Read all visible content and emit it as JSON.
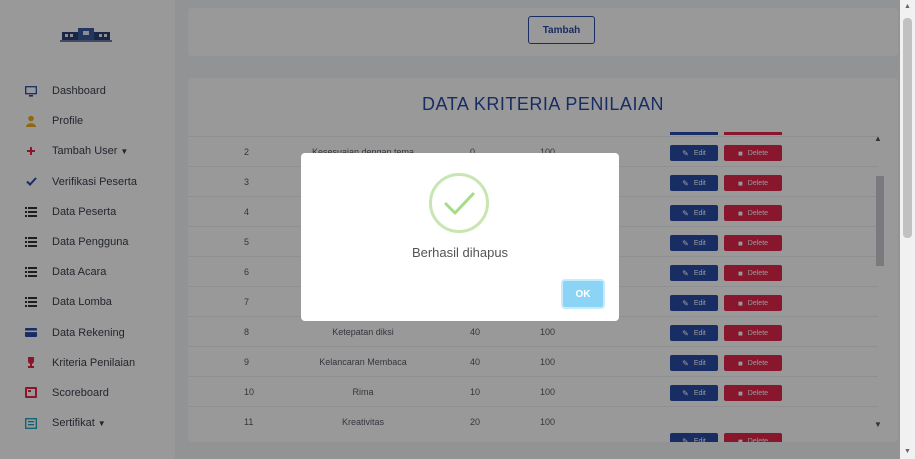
{
  "sidebar": {
    "logo": "school-building-logo",
    "items": [
      {
        "label": "Dashboard",
        "icon": "monitor-icon",
        "color": "#2b4ca8"
      },
      {
        "label": "Profile",
        "icon": "user-icon",
        "color": "#f0ad1d"
      },
      {
        "label": "Tambah User",
        "icon": "plus-icon",
        "color": "#e3264a",
        "dropdown": true
      },
      {
        "label": "Verifikasi Peserta",
        "icon": "check-icon",
        "color": "#2b4ca8"
      },
      {
        "label": "Data Peserta",
        "icon": "list-icon",
        "color": "#333333"
      },
      {
        "label": "Data Pengguna",
        "icon": "list-icon",
        "color": "#333333"
      },
      {
        "label": "Data Acara",
        "icon": "list-icon",
        "color": "#333333"
      },
      {
        "label": "Data Lomba",
        "icon": "list-icon",
        "color": "#333333"
      },
      {
        "label": "Data Rekening",
        "icon": "credit-card-icon",
        "color": "#2b4ca8"
      },
      {
        "label": "Kriteria Penilaian",
        "icon": "trophy-icon",
        "color": "#e3264a"
      },
      {
        "label": "Scoreboard",
        "icon": "scoreboard-icon",
        "color": "#e3264a"
      },
      {
        "label": "Sertifikat",
        "icon": "certificate-icon",
        "color": "#17a2b8",
        "dropdown": true
      }
    ]
  },
  "toolbar": {
    "tambah_label": "Tambah"
  },
  "table": {
    "title": "DATA KRITERIA PENILAIAN",
    "rows": [
      {
        "no": "2",
        "name": "Kesesuaian dengan tema",
        "bobot": "0",
        "max": "100"
      },
      {
        "no": "3",
        "name": "",
        "bobot": "",
        "max": ""
      },
      {
        "no": "4",
        "name": "",
        "bobot": "",
        "max": ""
      },
      {
        "no": "5",
        "name": "",
        "bobot": "",
        "max": ""
      },
      {
        "no": "6",
        "name": "",
        "bobot": "",
        "max": ""
      },
      {
        "no": "7",
        "name": "",
        "bobot": "",
        "max": ""
      },
      {
        "no": "8",
        "name": "Ketepatan diksi",
        "bobot": "40",
        "max": "100"
      },
      {
        "no": "9",
        "name": "Kelancaran Membaca",
        "bobot": "40",
        "max": "100"
      },
      {
        "no": "10",
        "name": "Rima",
        "bobot": "10",
        "max": "100"
      },
      {
        "no": "11",
        "name": "Kreativitas",
        "bobot": "20",
        "max": "100"
      }
    ],
    "edit_label": "Edit",
    "delete_label": "Delete"
  },
  "modal": {
    "message": "Berhasil dihapus",
    "ok_label": "OK",
    "icon": "success-check-icon"
  },
  "colors": {
    "primary": "#2b4ca8",
    "danger": "#e3264a",
    "success": "#a5dc86",
    "ok_button": "#8cd4f5"
  }
}
